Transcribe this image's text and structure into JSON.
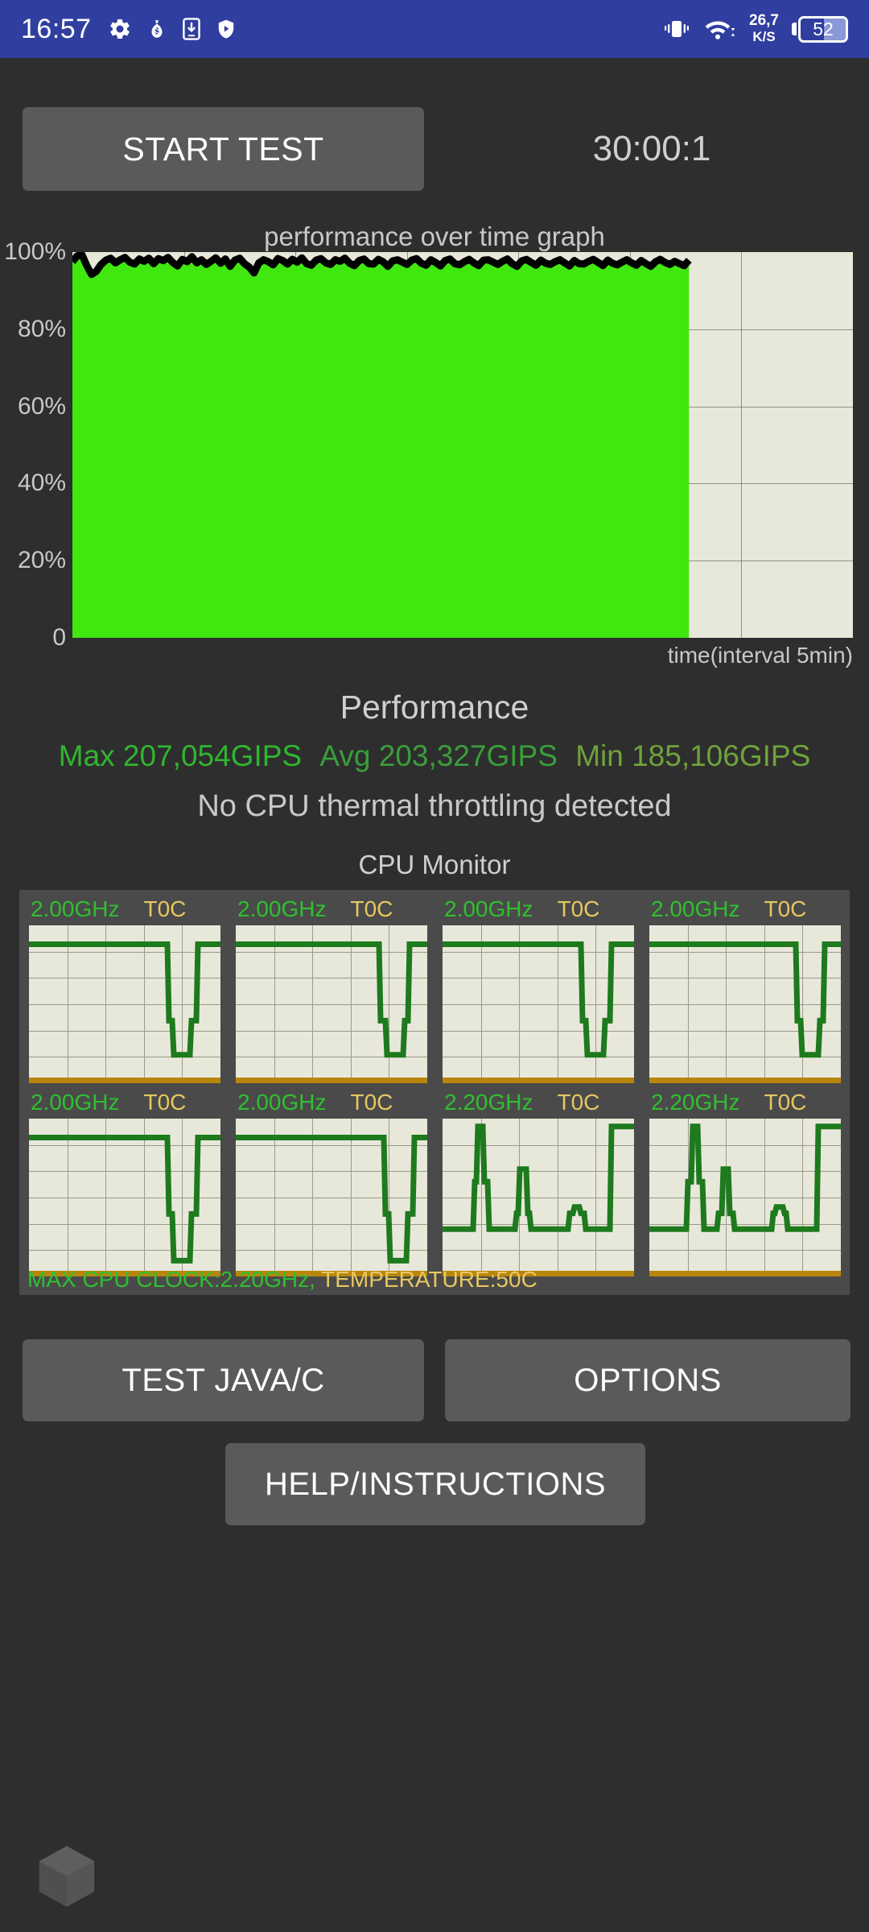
{
  "status_bar": {
    "time": "16:57",
    "left_icons": [
      "gear-icon",
      "money-bag-icon",
      "phone-download-icon",
      "shield-play-icon"
    ],
    "right_icons": [
      "vibrate-icon",
      "wifi-icon"
    ],
    "net_speed_value": "26,7",
    "net_speed_unit": "K/S",
    "battery_percent": "52",
    "bar_color": "#303f9f"
  },
  "toolbar": {
    "start_label": "START TEST",
    "timer": "30:00:1"
  },
  "graph": {
    "title": "performance over time graph",
    "xlabel": "time(interval 5min)",
    "y_ticks": [
      "100%",
      "80%",
      "60%",
      "40%",
      "20%",
      "0"
    ]
  },
  "performance": {
    "heading": "Performance",
    "max_label": "Max 207,054GIPS",
    "avg_label": "Avg 203,327GIPS",
    "min_label": "Min 185,106GIPS",
    "max_color": "#2fb62f",
    "avg_color": "#3a9e3a",
    "min_color": "#6fa33a",
    "throttle_message": "No CPU thermal throttling detected"
  },
  "cpu_monitor": {
    "heading": "CPU Monitor",
    "cores": [
      {
        "freq": "2.00GHz",
        "temp": "T0C"
      },
      {
        "freq": "2.00GHz",
        "temp": "T0C"
      },
      {
        "freq": "2.00GHz",
        "temp": "T0C"
      },
      {
        "freq": "2.00GHz",
        "temp": "T0C"
      },
      {
        "freq": "2.00GHz",
        "temp": "T0C"
      },
      {
        "freq": "2.00GHz",
        "temp": "T0C"
      },
      {
        "freq": "2.20GHz",
        "temp": "T0C"
      },
      {
        "freq": "2.20GHz",
        "temp": "T0C"
      }
    ],
    "status_clock": "MAX CPU CLOCK:2.20GHz,",
    "status_temp": "TEMPERATURE:50C"
  },
  "buttons": {
    "test_javac": "TEST JAVA/C",
    "options": "OPTIONS",
    "help": "HELP/INSTRUCTIONS"
  },
  "floating": {
    "icon": "hexagon-cube-icon"
  },
  "chart_data": {
    "type": "area",
    "title": "performance over time graph",
    "xlabel": "time(interval 5min)",
    "ylabel": "",
    "ylim": [
      0,
      100
    ],
    "y_tick_values": [
      0,
      20,
      40,
      60,
      80,
      100
    ],
    "x_gridlines": 5,
    "grid": true,
    "fill_color": "#40e810",
    "line_color": "#000000",
    "plot_background": "#e8e8da",
    "completed_fraction": 0.79,
    "series": [
      {
        "name": "performance",
        "unit": "percent of max",
        "values": [
          97.5,
          99.0,
          99.3,
          96.5,
          94.2,
          95.0,
          96.8,
          97.9,
          98.4,
          97.2,
          98.0,
          98.6,
          97.4,
          96.9,
          98.2,
          97.6,
          98.4,
          97.0,
          98.3,
          97.8,
          98.6,
          97.3,
          96.4,
          98.1,
          97.5,
          98.8,
          97.2,
          98.0,
          96.8,
          97.6,
          98.5,
          97.1,
          98.2,
          96.3,
          97.9,
          98.4,
          97.0,
          96.1,
          94.6,
          97.2,
          98.0,
          97.5,
          96.7,
          98.3,
          97.8,
          96.9,
          98.1,
          97.4,
          98.5,
          97.0,
          96.6,
          97.9,
          98.3,
          97.2,
          96.8,
          98.0,
          97.6,
          98.4,
          97.1,
          96.5,
          97.8,
          98.2,
          97.0,
          96.9,
          98.1,
          97.5,
          96.3,
          97.7,
          98.0,
          97.4,
          96.8,
          97.9,
          98.3,
          97.1,
          96.6,
          98.0,
          97.3,
          96.4,
          97.8,
          98.2,
          97.0,
          96.7,
          97.5,
          98.1,
          97.2,
          96.5,
          97.9,
          98.0,
          97.4,
          96.8,
          97.6,
          98.2,
          97.0,
          96.3,
          97.7,
          98.1,
          97.3,
          96.6,
          97.9,
          97.1,
          96.8,
          97.5,
          98.0,
          97.2,
          96.4,
          97.8,
          97.0,
          96.9,
          97.6,
          98.1,
          97.3,
          96.5,
          97.9,
          97.1,
          96.7,
          97.4,
          98.0,
          97.2,
          96.6,
          97.8,
          97.0,
          96.3,
          97.5,
          98.1,
          97.3,
          96.8,
          97.6,
          97.0,
          96.5,
          97.9
        ]
      }
    ],
    "core_traces": [
      {
        "core": 1,
        "pattern": "steady-high-with-dip",
        "baseline": 88,
        "dip_to": 18,
        "dip_at": 0.8
      },
      {
        "core": 2,
        "pattern": "steady-high-with-dip",
        "baseline": 88,
        "dip_to": 18,
        "dip_at": 0.83
      },
      {
        "core": 3,
        "pattern": "steady-high-with-dip",
        "baseline": 88,
        "dip_to": 18,
        "dip_at": 0.8
      },
      {
        "core": 4,
        "pattern": "steady-high-with-dip",
        "baseline": 88,
        "dip_to": 18,
        "dip_at": 0.84
      },
      {
        "core": 5,
        "pattern": "steady-high-with-dip",
        "baseline": 88,
        "dip_to": 10,
        "dip_at": 0.8
      },
      {
        "core": 6,
        "pattern": "steady-high-with-dip",
        "baseline": 88,
        "dip_to": 10,
        "dip_at": 0.85
      },
      {
        "core": 7,
        "pattern": "spiky-low-baseline",
        "baseline": 30,
        "peaks": [
          0.2,
          0.42,
          0.7
        ],
        "end_high": true
      },
      {
        "core": 8,
        "pattern": "spiky-low-baseline",
        "baseline": 30,
        "peaks": [
          0.24,
          0.4,
          0.68
        ],
        "end_high": true
      }
    ]
  }
}
